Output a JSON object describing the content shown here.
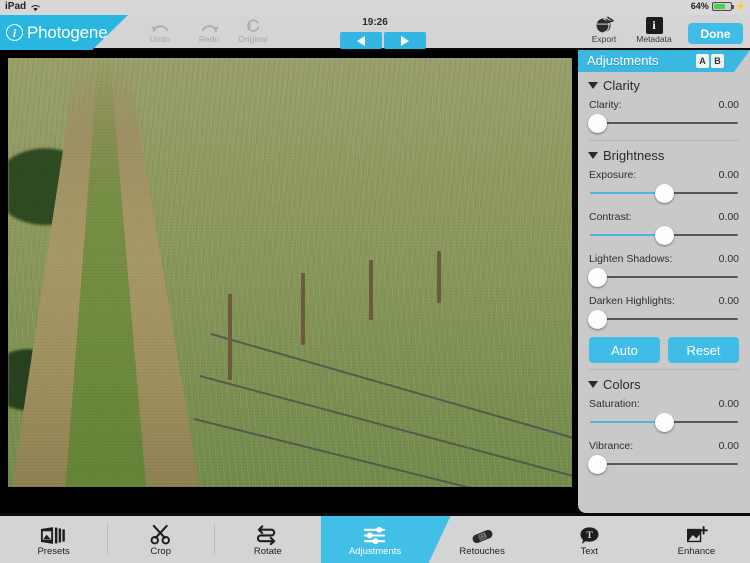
{
  "status_bar": {
    "device": "iPad",
    "wifi_icon": "wifi-icon",
    "battery_percent": "64%",
    "charging_icon": "lightning-bolt-icon"
  },
  "top_bar": {
    "brand": "Photogene",
    "info_icon": "info-circle-icon",
    "clock": "19:26",
    "history": [
      {
        "label": "Undo",
        "icon": "undo-arrow-icon",
        "enabled": false
      },
      {
        "label": "Redo",
        "icon": "redo-arrow-icon",
        "enabled": false
      },
      {
        "label": "Original",
        "icon": "compare-original-icon",
        "enabled": false
      }
    ],
    "nav": {
      "prev_icon": "triangle-left-icon",
      "next_icon": "triangle-right-icon"
    },
    "actions": [
      {
        "label": "Export",
        "icon": "export-globe-icon"
      },
      {
        "label": "Metadata",
        "icon": "info-i-icon"
      }
    ],
    "done_label": "Done"
  },
  "panel": {
    "title": "Adjustments",
    "ab_buttons": [
      "A",
      "B"
    ],
    "groups": [
      {
        "name": "Clarity",
        "caret_icon": "caret-down-icon",
        "controls": [
          {
            "label": "Clarity:",
            "value": "0.00",
            "knob_pct": 0,
            "fill": false
          }
        ]
      },
      {
        "name": "Brightness",
        "caret_icon": "caret-down-icon",
        "controls": [
          {
            "label": "Exposure:",
            "value": "0.00",
            "knob_pct": 50,
            "fill": true
          },
          {
            "label": "Contrast:",
            "value": "0.00",
            "knob_pct": 50,
            "fill": true
          },
          {
            "label": "Lighten Shadows:",
            "value": "0.00",
            "knob_pct": 0,
            "fill": false
          },
          {
            "label": "Darken Highlights:",
            "value": "0.00",
            "knob_pct": 0,
            "fill": false
          }
        ],
        "buttons": [
          "Auto",
          "Reset"
        ]
      },
      {
        "name": "Colors",
        "caret_icon": "caret-down-icon",
        "controls": [
          {
            "label": "Saturation:",
            "value": "0.00",
            "knob_pct": 50,
            "fill": true
          },
          {
            "label": "Vibrance:",
            "value": "0.00",
            "knob_pct": 0,
            "fill": false
          }
        ]
      }
    ]
  },
  "tab_bar": {
    "items": [
      {
        "label": "Presets",
        "icon": "presets-filmstrip-icon",
        "active": false
      },
      {
        "label": "Crop",
        "icon": "scissors-icon",
        "active": false
      },
      {
        "label": "Rotate",
        "icon": "rotate-loop-icon",
        "active": false
      },
      {
        "label": "Adjustments",
        "icon": "sliders-icon",
        "active": true
      },
      {
        "label": "Retouches",
        "icon": "bandage-icon",
        "active": false
      },
      {
        "label": "Text",
        "icon": "text-bubble-icon",
        "active": false
      },
      {
        "label": "Enhance",
        "icon": "enhance-sparkle-icon",
        "active": false
      }
    ]
  },
  "canvas": {
    "photo_alt": "country-lane-photo"
  },
  "colors": {
    "accent": "#3fbde6",
    "toolbar_bg": "#d4d4d4",
    "panel_bg": "#c9c9c9",
    "slider_fill": "#4ab6e0",
    "battery_green": "#4cd04c"
  }
}
